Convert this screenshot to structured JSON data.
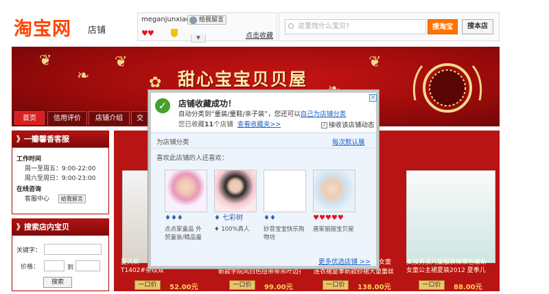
{
  "header": {
    "logo_text": "淘宝网",
    "logo_sub": "店铺",
    "seller_name": "meganjunxiao",
    "message_button": "给我留言",
    "rating_hearts": "♥♥",
    "favorite_link": "点击收藏",
    "search_placeholder": "这里找什么宝贝?",
    "btn_search_taobao": "搜淘宝",
    "btn_search_shop": "搜本店",
    "dropdown": "▼"
  },
  "banner": {
    "shop_title": "甜心宝宝贝贝屋"
  },
  "nav": {
    "tabs": [
      {
        "label": "首页"
      },
      {
        "label": "信用评价"
      },
      {
        "label": "店铺介绍"
      },
      {
        "label": "交"
      }
    ]
  },
  "sidebar": {
    "service_title": "》一瓣馨香客服",
    "work_hours_label": "工作时间",
    "weekday": "周一至周五：9:00-22:00",
    "weekend": "周六至周日：9:00-23:00",
    "online_label": "在线咨询",
    "customer_center": "客服中心",
    "msg_btn": "给我留言",
    "search_title": "》搜索店内宝贝",
    "keyword_label": "关键字：",
    "price_label": "价格：",
    "price_to": "到",
    "search_btn": "搜索"
  },
  "products": [
    {
      "name": "夏天新",
      "name2": "T1402#条纹双色吊带女童连",
      "btn": "一口价",
      "price": "52.00元"
    },
    {
      "name": "",
      "name2": "新款学院风白色扭带带吊叶边花",
      "btn": "一口价",
      "price": "99.00元"
    },
    {
      "name": "女童",
      "name2": "连衣裙夏季新款纱裙大童蕾丝",
      "btn": "一口价",
      "price": "138.00元"
    },
    {
      "name": "女孩男孩儿童服装棒果色薯斯",
      "name2": "女童公主裙夏装2012 夏季儿",
      "btn": "一口价",
      "price": "88.00元"
    }
  ],
  "modal": {
    "title": "店铺收藏成功！",
    "line1_prefix": "自动分类到“童装/童鞋/亲子装”，您还可以",
    "line1_link": "自己为店铺分类",
    "line2_prefix": "您已收藏",
    "line2_count": "11",
    "line2_suffix": "个店铺",
    "line2_link": "查看收藏夹>>",
    "checkbox_label": "接收该店铺动态",
    "section1_label": "为店铺分类",
    "section1_link": "每次默认展开？",
    "section2_label": "喜欢此店铺的人还喜欢：",
    "shops": [
      {
        "icons": "♦♦♦",
        "name": "点点家童品 外贸童装/精品童"
      },
      {
        "icons": "♦ 七彩树",
        "name": "♦ 100%真人"
      },
      {
        "icons": "♦♦",
        "name": "妙音宝宝快乐购物坊"
      },
      {
        "icons": "♥♥♥♥♥",
        "name": "唐家丽丽宝贝屋"
      }
    ],
    "more_link": "更多优选店铺 >>",
    "close": "×"
  }
}
